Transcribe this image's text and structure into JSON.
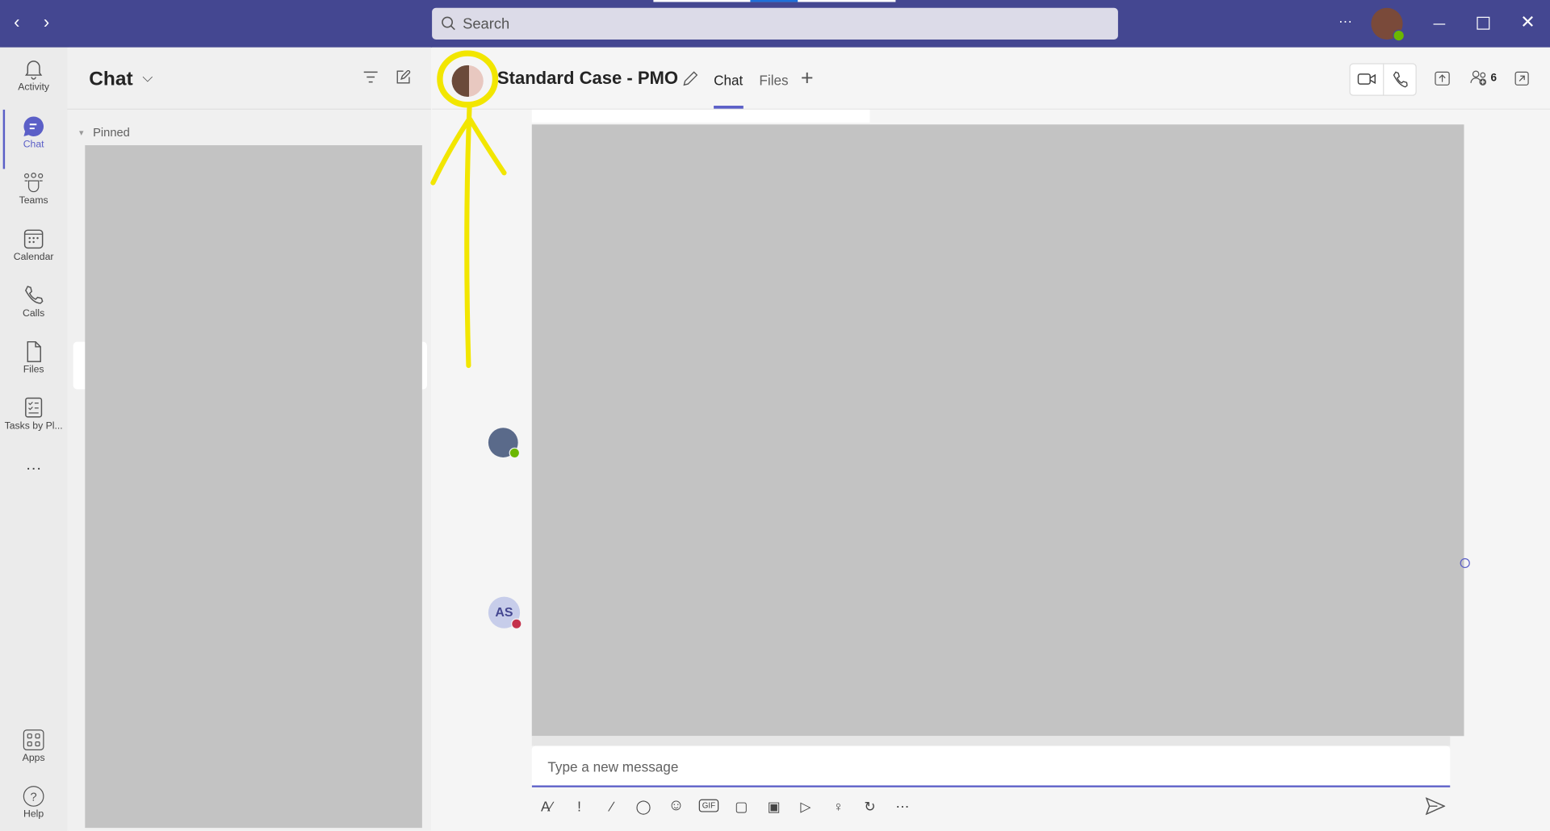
{
  "titlebar": {
    "search_placeholder": "Search",
    "more": "···"
  },
  "rail": {
    "items": [
      {
        "label": "Activity",
        "icon": "bell-icon"
      },
      {
        "label": "Chat",
        "icon": "chat-icon",
        "active": true
      },
      {
        "label": "Teams",
        "icon": "teams-icon"
      },
      {
        "label": "Calendar",
        "icon": "calendar-icon"
      },
      {
        "label": "Calls",
        "icon": "phone-icon"
      },
      {
        "label": "Files",
        "icon": "file-icon"
      },
      {
        "label": "Tasks by Pl...",
        "icon": "tasks-icon"
      }
    ],
    "more": "···",
    "apps": "Apps",
    "help": "Help"
  },
  "chatlist": {
    "title": "Chat",
    "section": "Pinned"
  },
  "conversation": {
    "title": "Standard Case - PMO",
    "tabs": [
      "Chat",
      "Files"
    ],
    "active_tab": "Chat",
    "participants_count": "6"
  },
  "messages": {
    "avatar_initials": "AS"
  },
  "compose": {
    "placeholder": "Type a new message"
  },
  "colors": {
    "accent": "#5b5fc7",
    "titlebar": "#444791",
    "annotation": "#f2e600",
    "redaction": "#c3c3c3"
  }
}
